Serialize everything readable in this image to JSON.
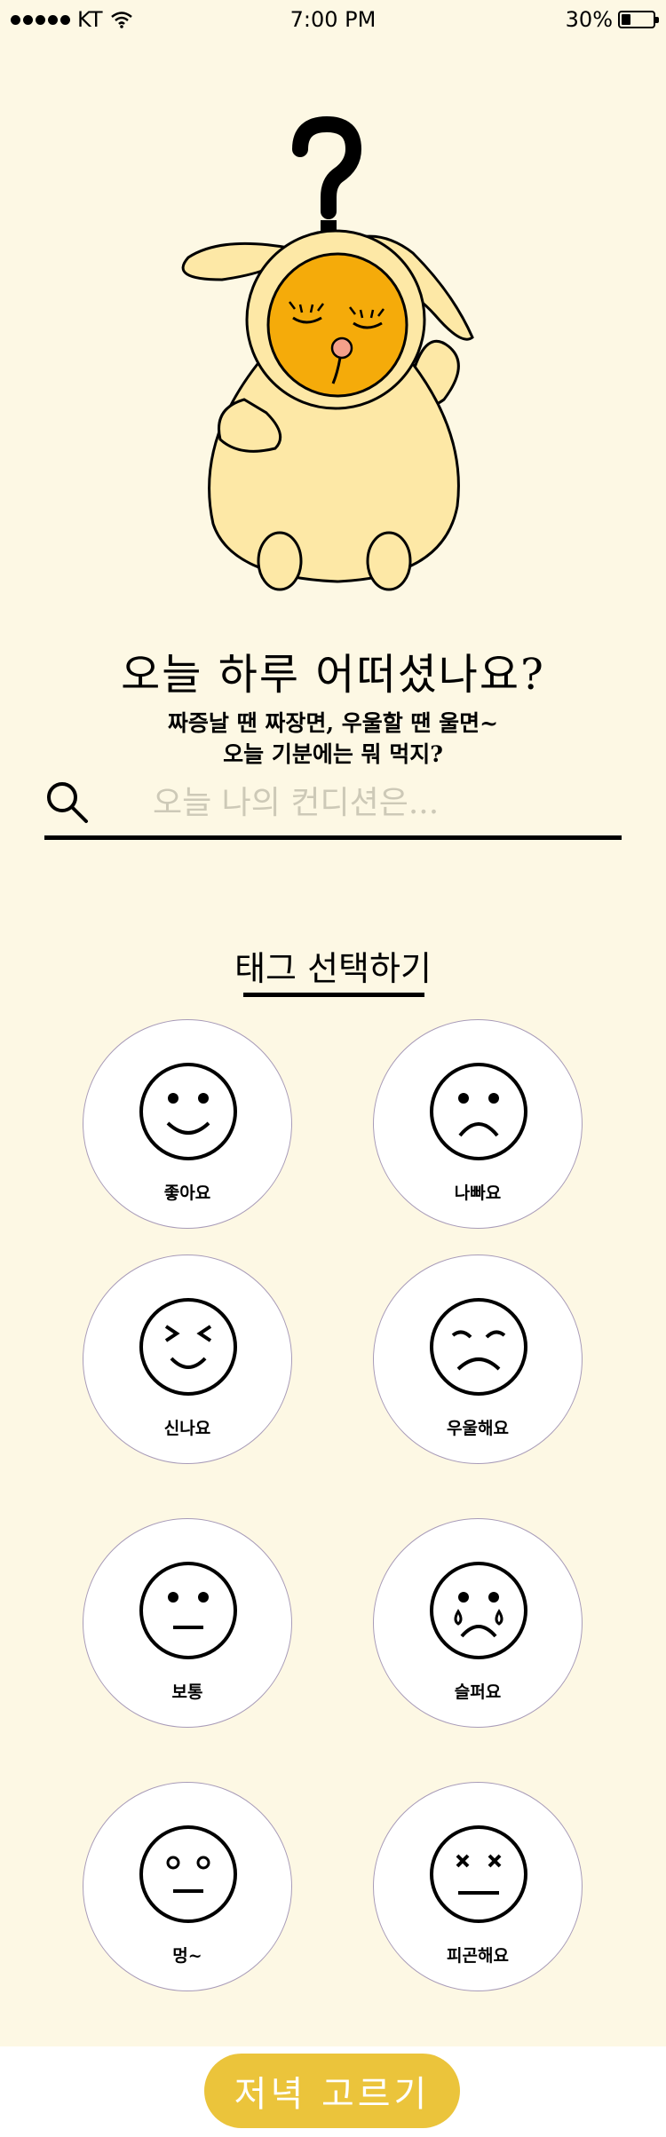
{
  "status_bar": {
    "carrier": "KT",
    "time": "7:00 PM",
    "battery_percent": "30%",
    "battery_level": 0.3
  },
  "header": {
    "headline": "오늘 하루 어떠셨나요?",
    "subline1": "짜증날 땐 짜장면, 우울할 땐 울면~",
    "subline2": "오늘 기분에는 뭐 먹지?"
  },
  "search": {
    "placeholder": "오늘 나의 컨디션은..."
  },
  "tags_section": {
    "title": "태그 선택하기",
    "items": [
      {
        "label": "좋아요",
        "icon": "happy-face-icon"
      },
      {
        "label": "나빠요",
        "icon": "frown-face-icon"
      },
      {
        "label": "신나요",
        "icon": "excited-face-icon"
      },
      {
        "label": "우울해요",
        "icon": "gloomy-face-icon"
      },
      {
        "label": "보통",
        "icon": "neutral-face-icon"
      },
      {
        "label": "슬퍼요",
        "icon": "crying-face-icon"
      },
      {
        "label": "멍~",
        "icon": "blank-face-icon"
      },
      {
        "label": "피곤해요",
        "icon": "dizzy-face-icon"
      }
    ]
  },
  "footer": {
    "button_label": "저녁 고르기"
  },
  "colors": {
    "background": "#fdf8e4",
    "accent": "#ebc43b",
    "mascot_body": "#fde8a6",
    "mascot_face": "#f5ab0a"
  }
}
